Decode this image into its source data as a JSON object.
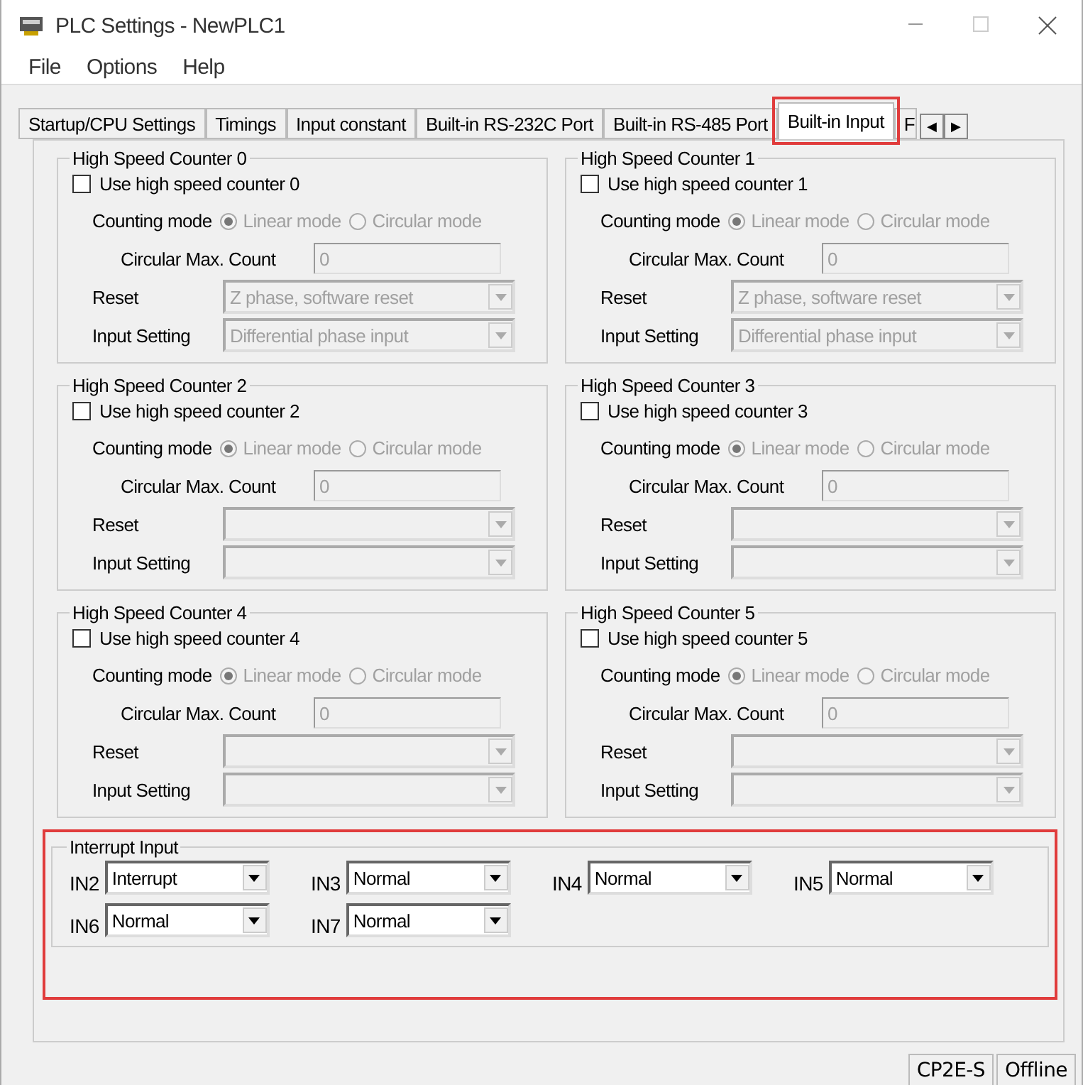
{
  "window": {
    "title": "PLC Settings - NewPLC1"
  },
  "menu": [
    "File",
    "Options",
    "Help"
  ],
  "tabs": [
    {
      "label": "Startup/CPU Settings",
      "selected": false,
      "highlighted": false
    },
    {
      "label": "Timings",
      "selected": false,
      "highlighted": false
    },
    {
      "label": "Input constant",
      "selected": false,
      "highlighted": false
    },
    {
      "label": "Built-in RS-232C Port",
      "selected": false,
      "highlighted": false
    },
    {
      "label": "Built-in RS-485 Port",
      "selected": false,
      "highlighted": false
    },
    {
      "label": "Built-in Input",
      "selected": true,
      "highlighted": true
    },
    {
      "label": "F",
      "selected": false,
      "highlighted": false
    }
  ],
  "tab_scroll": [
    "◀",
    "▶"
  ],
  "counters": [
    {
      "title": "High Speed Counter 0",
      "use_label": "Use high speed counter 0",
      "checked": false,
      "disabled": true,
      "mode_label": "Counting mode",
      "modes": [
        {
          "label": "Linear mode",
          "selected": true
        },
        {
          "label": "Circular mode",
          "selected": false
        }
      ],
      "max_label": "Circular Max. Count",
      "max_value": "0",
      "reset_label": "Reset",
      "reset_value": "Z phase, software reset",
      "input_label": "Input Setting",
      "input_value": "Differential phase input"
    },
    {
      "title": "High Speed Counter 1",
      "use_label": "Use high speed counter 1",
      "checked": false,
      "disabled": true,
      "mode_label": "Counting mode",
      "modes": [
        {
          "label": "Linear mode",
          "selected": true
        },
        {
          "label": "Circular mode",
          "selected": false
        }
      ],
      "max_label": "Circular Max. Count",
      "max_value": "0",
      "reset_label": "Reset",
      "reset_value": "Z phase, software reset",
      "input_label": "Input Setting",
      "input_value": "Differential phase input"
    },
    {
      "title": "High Speed Counter 2",
      "use_label": "Use high speed counter 2",
      "checked": false,
      "disabled": true,
      "mode_label": "Counting mode",
      "modes": [
        {
          "label": "Linear mode",
          "selected": true
        },
        {
          "label": "Circular mode",
          "selected": false
        }
      ],
      "max_label": "Circular Max. Count",
      "max_value": "0",
      "reset_label": "Reset",
      "input_label": "Input Setting"
    },
    {
      "title": "High Speed Counter 3",
      "use_label": "Use high speed counter 3",
      "checked": false,
      "disabled": true,
      "mode_label": "Counting mode",
      "modes": [
        {
          "label": "Linear mode",
          "selected": true
        },
        {
          "label": "Circular mode",
          "selected": false
        }
      ],
      "max_label": "Circular Max. Count",
      "max_value": "0",
      "reset_label": "Reset",
      "input_label": "Input Setting"
    },
    {
      "title": "High Speed Counter 4",
      "use_label": "Use high speed counter 4",
      "checked": false,
      "disabled": true,
      "mode_label": "Counting mode",
      "modes": [
        {
          "label": "Linear mode",
          "selected": true
        },
        {
          "label": "Circular mode",
          "selected": false
        }
      ],
      "max_label": "Circular Max. Count",
      "max_value": "0",
      "reset_label": "Reset",
      "input_label": "Input Setting"
    },
    {
      "title": "High Speed Counter 5",
      "use_label": "Use high speed counter 5",
      "checked": false,
      "disabled": true,
      "mode_label": "Counting mode",
      "modes": [
        {
          "label": "Linear mode",
          "selected": true
        },
        {
          "label": "Circular mode",
          "selected": false
        }
      ],
      "max_label": "Circular Max. Count",
      "max_value": "0",
      "reset_label": "Reset",
      "input_label": "Input Setting"
    }
  ],
  "interrupt": {
    "title": "Interrupt Input",
    "highlighted": true,
    "inputs": [
      {
        "label": "IN2",
        "value": "Interrupt"
      },
      {
        "label": "IN3",
        "value": "Normal"
      },
      {
        "label": "IN4",
        "value": "Normal"
      },
      {
        "label": "IN5",
        "value": "Normal"
      },
      {
        "label": "IN6",
        "value": "Normal"
      },
      {
        "label": "IN7",
        "value": "Normal"
      }
    ]
  },
  "status_bar": [
    "CP2E-S",
    "Offline"
  ]
}
